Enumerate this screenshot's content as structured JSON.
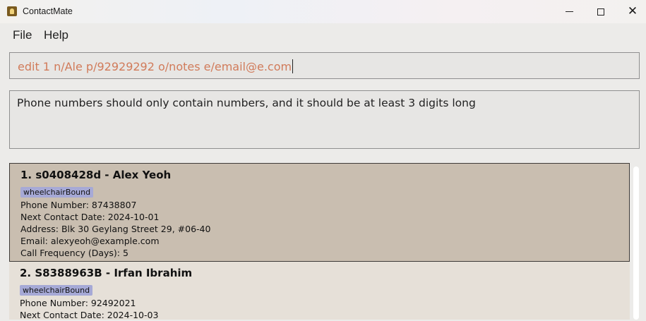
{
  "window": {
    "title": "ContactMate",
    "controls": {
      "minimize": "minimize-icon",
      "maximize": "maximize-icon",
      "close": "close-icon"
    }
  },
  "menu": [
    "File",
    "Help"
  ],
  "command": {
    "value": "edit 1 n/Ale p/92929292 o/notes e/email@e.com",
    "text_color": "#d17b5a"
  },
  "result": {
    "message": "Phone numbers should only contain numbers, and it should be at least 3 digits long"
  },
  "persons": [
    {
      "index": "1.",
      "id": "s0408428d",
      "name": "Alex Yeoh",
      "title": "1. s0408428d - Alex Yeoh",
      "tags": [
        "wheelchairBound"
      ],
      "phone": "Phone Number: 87438807",
      "next_contact": "Next Contact Date: 2024-10-01",
      "address": "Address: Blk 30 Geylang Street 29, #06-40",
      "email": "Email: alexyeoh@example.com",
      "call_frequency": "Call Frequency (Days): 5",
      "selected": true
    },
    {
      "index": "2.",
      "id": "S8388963B",
      "name": "Irfan Ibrahim",
      "title": "2. S8388963B - Irfan Ibrahim",
      "tags": [
        "wheelchairBound"
      ],
      "phone": "Phone Number: 92492021",
      "next_contact": "Next Contact Date: 2024-10-03",
      "selected": false
    }
  ],
  "colors": {
    "selected_card": "#c9beb0",
    "card": "#e6e0d8",
    "tag": "#a6a9d6"
  }
}
